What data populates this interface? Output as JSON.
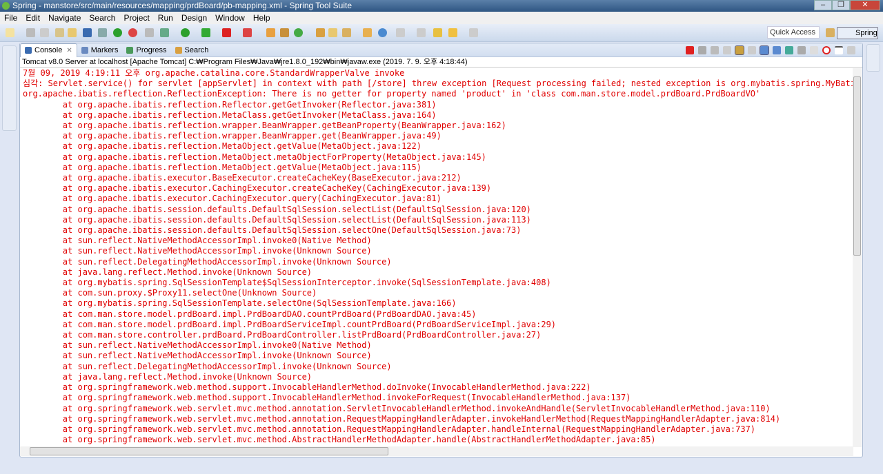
{
  "window": {
    "title": "Spring - manstore/src/main/resources/mapping/prdBoard/pb-mapping.xml - Spring Tool Suite",
    "minimize": "–",
    "maximize": "❐",
    "close": "✕"
  },
  "menu": [
    "File",
    "Edit",
    "Navigate",
    "Search",
    "Project",
    "Run",
    "Design",
    "Window",
    "Help"
  ],
  "toolbar": {
    "quick_access_placeholder": "Quick Access",
    "perspective": "Spring"
  },
  "tabs": [
    {
      "label": "Console",
      "active": true,
      "icon": "console-icon"
    },
    {
      "label": "Markers",
      "icon": "markers-icon"
    },
    {
      "label": "Progress",
      "icon": "progress-icon"
    },
    {
      "label": "Search",
      "icon": "search-icon"
    }
  ],
  "process_label": "Tomcat v8.0 Server at localhost [Apache Tomcat] C:₩Program Files₩Java₩jre1.8.0_192₩bin₩javaw.exe (2019. 7. 9. 오후 4:18:44)",
  "console_color": "#e00000",
  "console_lines": [
    "7월 09, 2019 4:19:11 오후 org.apache.catalina.core.StandardWrapperValve invoke",
    "심각: Servlet.service() for servlet [appServlet] in context with path [/store] threw exception [Request processing failed; nested exception is org.mybatis.spring.MyBatis",
    "org.apache.ibatis.reflection.ReflectionException: There is no getter for property named 'product' in 'class com.man.store.model.prdBoard.PrdBoardVO'",
    "\tat org.apache.ibatis.reflection.Reflector.getGetInvoker(Reflector.java:381)",
    "\tat org.apache.ibatis.reflection.MetaClass.getGetInvoker(MetaClass.java:164)",
    "\tat org.apache.ibatis.reflection.wrapper.BeanWrapper.getBeanProperty(BeanWrapper.java:162)",
    "\tat org.apache.ibatis.reflection.wrapper.BeanWrapper.get(BeanWrapper.java:49)",
    "\tat org.apache.ibatis.reflection.MetaObject.getValue(MetaObject.java:122)",
    "\tat org.apache.ibatis.reflection.MetaObject.metaObjectForProperty(MetaObject.java:145)",
    "\tat org.apache.ibatis.reflection.MetaObject.getValue(MetaObject.java:115)",
    "\tat org.apache.ibatis.executor.BaseExecutor.createCacheKey(BaseExecutor.java:212)",
    "\tat org.apache.ibatis.executor.CachingExecutor.createCacheKey(CachingExecutor.java:139)",
    "\tat org.apache.ibatis.executor.CachingExecutor.query(CachingExecutor.java:81)",
    "\tat org.apache.ibatis.session.defaults.DefaultSqlSession.selectList(DefaultSqlSession.java:120)",
    "\tat org.apache.ibatis.session.defaults.DefaultSqlSession.selectList(DefaultSqlSession.java:113)",
    "\tat org.apache.ibatis.session.defaults.DefaultSqlSession.selectOne(DefaultSqlSession.java:73)",
    "\tat sun.reflect.NativeMethodAccessorImpl.invoke0(Native Method)",
    "\tat sun.reflect.NativeMethodAccessorImpl.invoke(Unknown Source)",
    "\tat sun.reflect.DelegatingMethodAccessorImpl.invoke(Unknown Source)",
    "\tat java.lang.reflect.Method.invoke(Unknown Source)",
    "\tat org.mybatis.spring.SqlSessionTemplate$SqlSessionInterceptor.invoke(SqlSessionTemplate.java:408)",
    "\tat com.sun.proxy.$Proxy11.selectOne(Unknown Source)",
    "\tat org.mybatis.spring.SqlSessionTemplate.selectOne(SqlSessionTemplate.java:166)",
    "\tat com.man.store.model.prdBoard.impl.PrdBoardDAO.countPrdBoard(PrdBoardDAO.java:45)",
    "\tat com.man.store.model.prdBoard.impl.PrdBoardServiceImpl.countPrdBoard(PrdBoardServiceImpl.java:29)",
    "\tat com.man.store.controller.prdBoard.PrdBoardController.listPrdBoard(PrdBoardController.java:27)",
    "\tat sun.reflect.NativeMethodAccessorImpl.invoke0(Native Method)",
    "\tat sun.reflect.NativeMethodAccessorImpl.invoke(Unknown Source)",
    "\tat sun.reflect.DelegatingMethodAccessorImpl.invoke(Unknown Source)",
    "\tat java.lang.reflect.Method.invoke(Unknown Source)",
    "\tat org.springframework.web.method.support.InvocableHandlerMethod.doInvoke(InvocableHandlerMethod.java:222)",
    "\tat org.springframework.web.method.support.InvocableHandlerMethod.invokeForRequest(InvocableHandlerMethod.java:137)",
    "\tat org.springframework.web.servlet.mvc.method.annotation.ServletInvocableHandlerMethod.invokeAndHandle(ServletInvocableHandlerMethod.java:110)",
    "\tat org.springframework.web.servlet.mvc.method.annotation.RequestMappingHandlerAdapter.invokeHandlerMethod(RequestMappingHandlerAdapter.java:814)",
    "\tat org.springframework.web.servlet.mvc.method.annotation.RequestMappingHandlerAdapter.handleInternal(RequestMappingHandlerAdapter.java:737)",
    "\tat org.springframework.web.servlet.mvc.method.AbstractHandlerMethodAdapter.handle(AbstractHandlerMethodAdapter.java:85)"
  ]
}
